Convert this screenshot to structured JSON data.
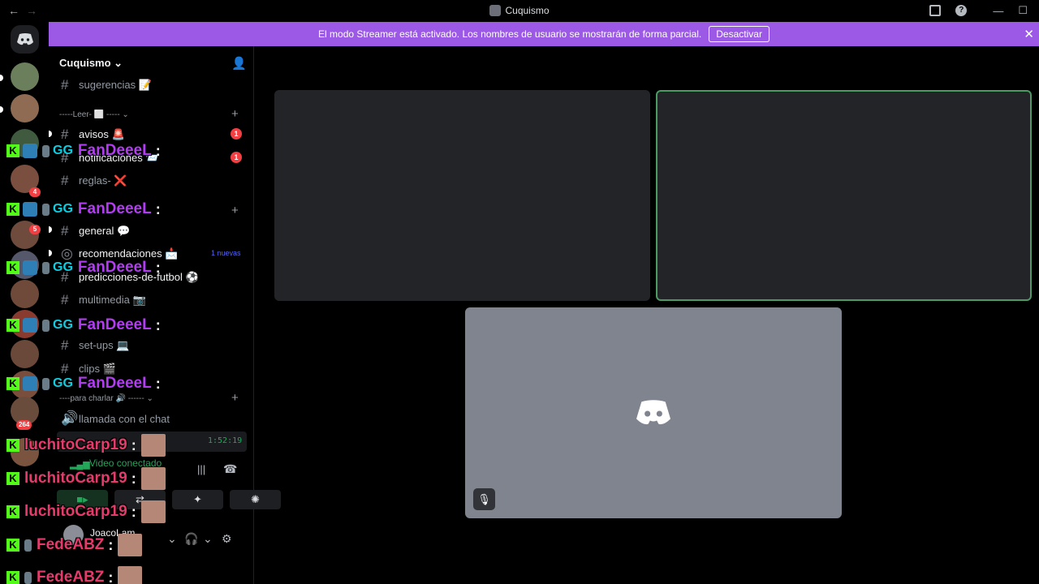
{
  "titlebar": {
    "back_label": "←",
    "forward_label": "→",
    "title": "Cuquismo",
    "minimize_label": "—",
    "maximize_label": "☐"
  },
  "banner": {
    "text": "El modo Streamer está activado. Los nombres de usuario se mostrarán de forma parcial.",
    "button_label": "Desactivar",
    "close_label": "✕"
  },
  "rail": {
    "badges": [
      "4",
      "5",
      "264"
    ],
    "colors": [
      "#6c7f5d",
      "#8f6b53",
      "#3f5a3e",
      "#7a4f3f",
      "#6e4b3c",
      "#55586b",
      "#6f4a3b",
      "#8a3b2f",
      "#6a493a",
      "#7a4e3c",
      "#6a4c3d",
      "#7b5440"
    ]
  },
  "sidebar": {
    "server_name": "Cuquismo",
    "channels": [
      {
        "name": "sugerencias 📝",
        "icon": "hash-icon",
        "unread": false
      },
      {
        "name": "avisos 🚨",
        "icon": "hash-icon",
        "unread": true,
        "mention": "1"
      },
      {
        "name": "notificaciones 📨",
        "icon": "hash-icon",
        "unread": true,
        "mention": "1"
      },
      {
        "name": "reglas- ❌",
        "icon": "hash-icon",
        "unread": false
      },
      {
        "name": "general 💬",
        "icon": "hash-icon",
        "unread": true
      },
      {
        "name": "recomendaciones 📩",
        "icon": "forum-icon",
        "unread": true,
        "new_label": "1 nuevas"
      },
      {
        "name": "predicciones-de-futbol ⚽",
        "icon": "hash-icon",
        "unread": true
      },
      {
        "name": "multimedia 📷",
        "icon": "hash-icon",
        "unread": false
      },
      {
        "name": "set-ups 💻",
        "icon": "hash-icon",
        "unread": false
      },
      {
        "name": "clips 🎬",
        "icon": "hash-icon",
        "unread": false
      },
      {
        "name": "llamada con el chat",
        "icon": "speaker-icon",
        "unread": false
      }
    ],
    "categories": [
      {
        "name": "-----Leer- ⬜ ----- ⌄"
      },
      {
        "name": "----para charlar 🔊 ------ ⌄"
      }
    ]
  },
  "voice": {
    "timer": "1:52:19",
    "status": "Video conectado"
  },
  "user": {
    "name": "JoacoLam"
  },
  "overlay_chat": [
    {
      "name": "FanDeeeL",
      "color": "#b13cf0",
      "full_badges": true
    },
    {
      "name": "FanDeeeL",
      "color": "#b13cf0",
      "full_badges": true
    },
    {
      "name": "FanDeeeL",
      "color": "#b13cf0",
      "full_badges": true
    },
    {
      "name": "FanDeeeL",
      "color": "#b13cf0",
      "full_badges": true
    },
    {
      "name": "FanDeeeL",
      "color": "#b13cf0",
      "full_badges": true
    },
    {
      "name": "luchitoCarp19",
      "color": "#e43b6b",
      "full_badges": false
    },
    {
      "name": "luchitoCarp19",
      "color": "#e43b6b",
      "full_badges": false
    },
    {
      "name": "luchitoCarp19",
      "color": "#e43b6b",
      "full_badges": false
    },
    {
      "name": "FedeABZ",
      "color": "#e43b6b",
      "full_badges": false,
      "tool_badge": true
    },
    {
      "name": "FedeABZ",
      "color": "#e43b6b",
      "full_badges": false,
      "tool_badge": true
    }
  ],
  "overlay_labels": {
    "k_badge": "K",
    "gg_badge": "GG",
    "colon": ":"
  },
  "colors": {
    "accent": "#5865f2",
    "banner": "#9b59e6",
    "connected": "#23a55a",
    "mention": "#f23f43",
    "speaking_border": "#4c9b63",
    "kick_green": "#53fc18"
  }
}
